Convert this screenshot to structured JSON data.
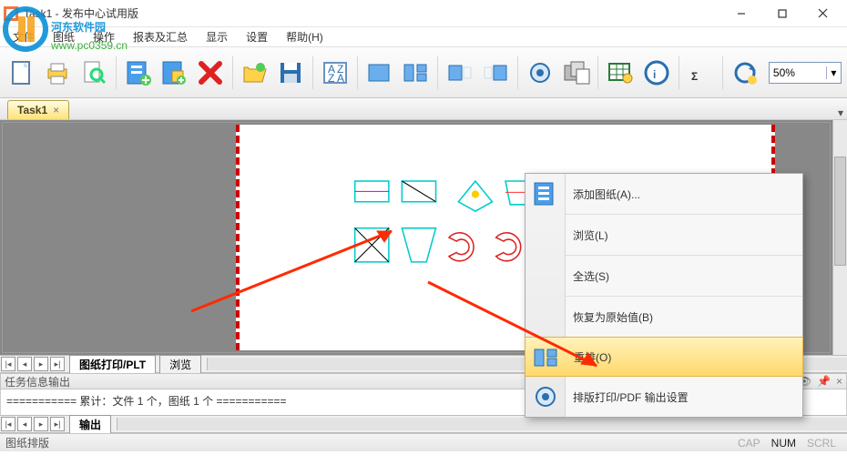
{
  "window": {
    "title": "Task1 - 发布中心试用版"
  },
  "watermark": {
    "line1": "河东软件园",
    "line2": "www.pc0359.cn"
  },
  "menubar": [
    "文件",
    "图纸",
    "操作",
    "报表及汇总",
    "显示",
    "设置",
    "帮助(H)"
  ],
  "toolbar": {
    "zoom_value": "50%"
  },
  "tab": {
    "label": "Task1"
  },
  "navtabs": {
    "tab1": "图纸打印/PLT",
    "tab2": "浏览"
  },
  "output_panel": {
    "title": "任务信息输出",
    "line": "=========== 累计：文件 1 个，图纸 1 个 ==========="
  },
  "bottomtabs": {
    "tab": "输出"
  },
  "status": {
    "left": "图纸排版",
    "cap": "CAP",
    "num": "NUM",
    "scrl": "SCRL"
  },
  "context": {
    "add": "添加图纸(A)...",
    "browse": "浏览(L)",
    "selectall": "全选(S)",
    "restore": "恢复为原始值(B)",
    "rearrange": "重排(O)",
    "print": "排版打印/PDF 输出设置"
  }
}
